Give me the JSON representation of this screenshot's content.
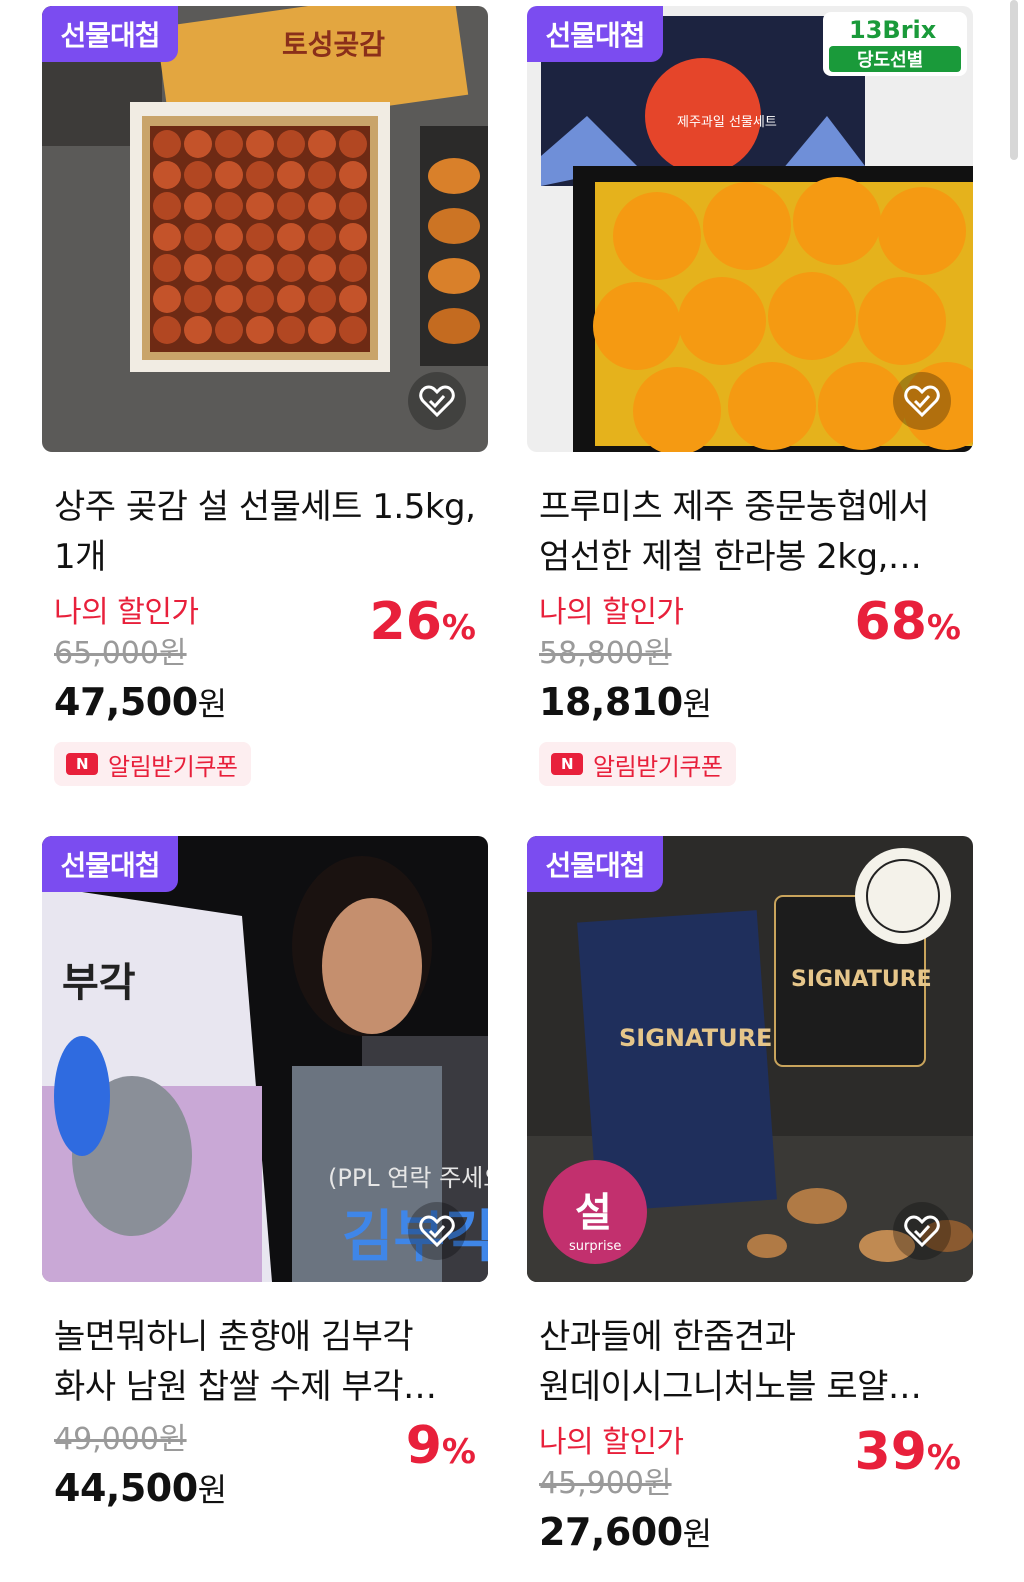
{
  "products": [
    {
      "badge": "선물대첩",
      "title_line1": "상주 곶감 설 선물세트 1.5kg,",
      "title_line2": "1개",
      "my_discount_label": "나의 할인가",
      "discount_pct": "26",
      "original_price": "65,000원",
      "price_number": "47,500",
      "price_unit": "원",
      "coupon_label": "알림받기쿠폰",
      "image_text": "토성곶감",
      "image_icon": "dried-persimmon-gift-box"
    },
    {
      "badge": "선물대첩",
      "title_line1": "프루미츠 제주 중문농협에서",
      "title_line2": "엄선한 제철 한라봉 2kg,…",
      "my_discount_label": "나의 할인가",
      "discount_pct": "68",
      "original_price": "58,800원",
      "price_number": "18,810",
      "price_unit": "원",
      "coupon_label": "알림받기쿠폰",
      "image_text": "제주과일 선물세트",
      "brix_line1": "13Brix",
      "brix_line2": "당도선별",
      "image_icon": "hallabong-gift-box"
    },
    {
      "badge": "선물대첩",
      "title_line1": "놀면뭐하니 춘향애 김부각",
      "title_line2": "화사 남원 찹쌀 수제 부각…",
      "discount_pct": "9",
      "original_price": "49,000원",
      "price_number": "44,500",
      "price_unit": "원",
      "image_text": "(PPL 연락 주세요",
      "image_text2": "김부각",
      "image_icon": "seaweed-snack-bag"
    },
    {
      "badge": "선물대첩",
      "title_line1": "산과들에 한줌견과",
      "title_line2": "원데이시그니처노블 로얄…",
      "my_discount_label": "나의 할인가",
      "discount_pct": "39",
      "original_price": "45,900원",
      "price_number": "27,600",
      "price_unit": "원",
      "image_text": "SIGNATURE",
      "image_text2": "설",
      "image_text3": "surprise",
      "image_icon": "nut-gift-pack"
    }
  ],
  "percent_symbol": "%",
  "coupon_icon_letter": "N",
  "colors": {
    "badge": "#7b4cf0",
    "accent_red": "#e8203b",
    "coupon_bg": "#fdeef0"
  }
}
